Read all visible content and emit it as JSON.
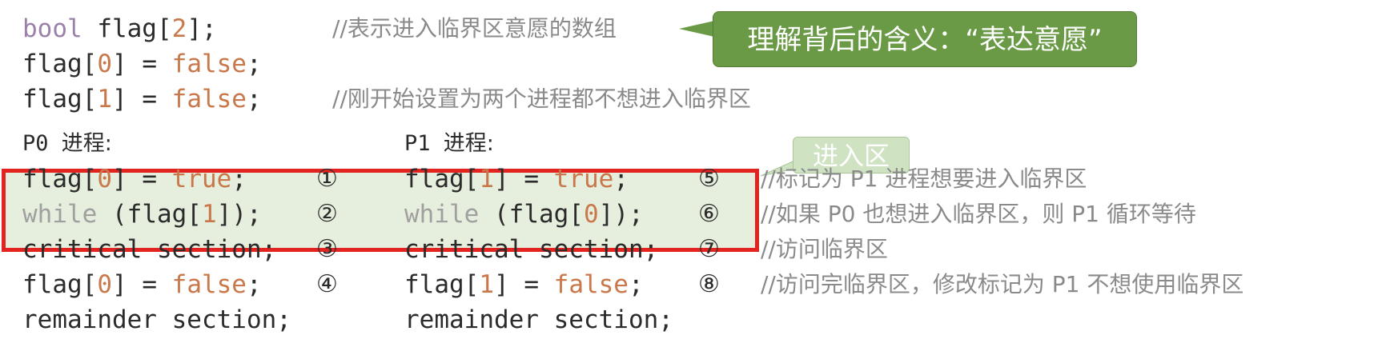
{
  "header_code": {
    "line1_kw": "bool",
    "line1_rest": " flag[",
    "line1_num": "2",
    "line1_end": "];",
    "line1_comment": "//表示进入临界区意愿的数组",
    "line2_a": "flag[",
    "line2_num": "0",
    "line2_b": "] = ",
    "line2_val": "false",
    "line2_end": ";",
    "line3_a": "flag[",
    "line3_num": "1",
    "line3_b": "] = ",
    "line3_val": "false",
    "line3_end": ";",
    "line3_comment": "//刚开始设置为两个进程都不想进入临界区"
  },
  "callouts": {
    "main": "理解背后的含义：“表达意愿”",
    "entry": "进入区"
  },
  "p0": {
    "title_en": "P0",
    "title_cn": "进程:",
    "lines": [
      {
        "a": "flag[",
        "n": "0",
        "b": "] = ",
        "v": "true",
        "e": ";",
        "step": "①"
      },
      {
        "kw": "while",
        "a": " (flag[",
        "n": "1",
        "b": "]);",
        "step": "②"
      },
      {
        "text": "critical section;",
        "step": "③"
      },
      {
        "a": "flag[",
        "n": "0",
        "b": "] = ",
        "v": "false",
        "e": ";",
        "step": "④"
      },
      {
        "text": "remainder section;"
      }
    ]
  },
  "p1": {
    "title_en": "P1",
    "title_cn": "进程:",
    "lines": [
      {
        "a": "flag[",
        "n": "1",
        "b": "] = ",
        "v": "true",
        "e": ";",
        "step": "⑤"
      },
      {
        "kw": "while",
        "a": " (flag[",
        "n": "0",
        "b": "]);",
        "step": "⑥"
      },
      {
        "text": "critical section;",
        "step": "⑦"
      },
      {
        "a": "flag[",
        "n": "1",
        "b": "] = ",
        "v": "false",
        "e": ";",
        "step": "⑧"
      },
      {
        "text": "remainder section;"
      }
    ]
  },
  "comments": [
    "//标记为 P1 进程想要进入临界区",
    "//如果 P0 也想进入临界区，则 P1 循环等待",
    "//访问临界区",
    "//访问完临界区，修改标记为 P1 不想使用临界区"
  ]
}
